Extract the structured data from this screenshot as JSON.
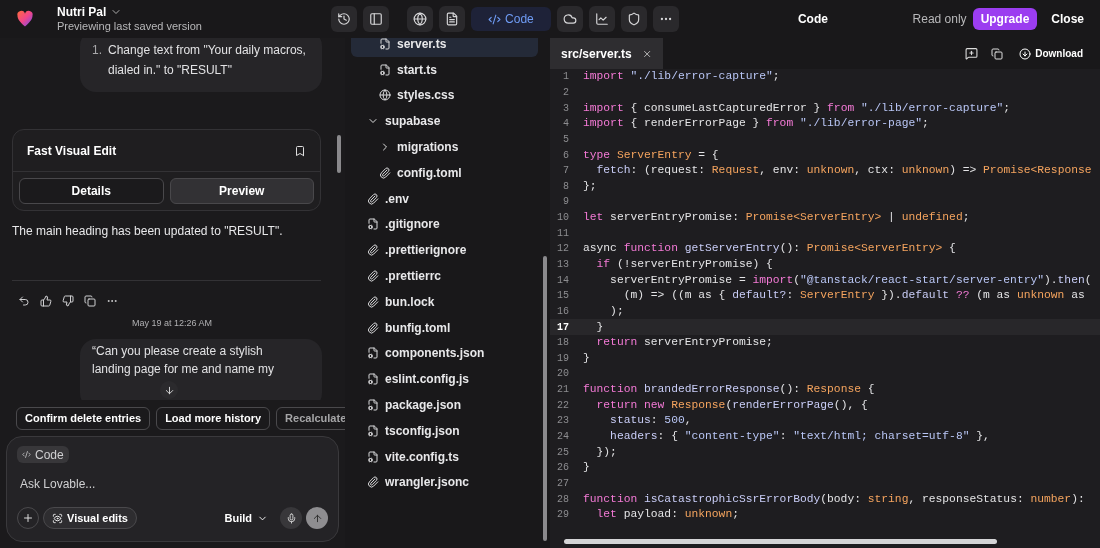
{
  "project": {
    "name": "Nutri Pal",
    "status": "Previewing last saved version"
  },
  "view_tabs": [
    {
      "label": "Code",
      "selected": true
    }
  ],
  "title": "Code",
  "access": "Read only",
  "upgrade_button": "Upgrade",
  "close_button": "Close",
  "chat": {
    "edit_list": [
      {
        "marker": "1.",
        "text": "Change text from \"Your daily macros, dialed in.\" to \"RESULT\""
      }
    ],
    "card": {
      "title": "Fast Visual Edit",
      "buttons": [
        {
          "label": "Details",
          "selected": false
        },
        {
          "label": "Preview",
          "selected": true
        }
      ]
    },
    "reply": "The main heading has been updated to \"RESULT\".",
    "timestamp": "May 19 at 12:26 AM",
    "user_message": "“Can you please create a stylish landing page for me and name my",
    "suggestions": [
      "Confirm delete entries",
      "Load more history",
      "Recalculate"
    ],
    "composer": {
      "tag": "Code",
      "placeholder": "Ask Lovable...",
      "visual_edits": "Visual edits",
      "mode": "Build"
    }
  },
  "tree": [
    {
      "children": [
        {
          "label": "server.ts",
          "kind": "ts",
          "selected": true
        },
        {
          "label": "start.ts",
          "kind": "ts",
          "selected": false
        },
        {
          "label": "styles.css",
          "kind": "css",
          "selected": false
        }
      ]
    },
    {
      "label": "supabase",
      "kind": "folder",
      "expanded": true,
      "selected": false,
      "children": [
        {
          "label": "migrations",
          "kind": "folder",
          "expanded": false,
          "selected": false
        },
        {
          "label": "config.toml",
          "kind": "clip",
          "selected": false
        }
      ]
    },
    {
      "label": ".env",
      "kind": "clip",
      "selected": false
    },
    {
      "label": ".gitignore",
      "kind": "ts",
      "selected": false
    },
    {
      "label": ".prettierignore",
      "kind": "clip",
      "selected": false
    },
    {
      "label": ".prettierrc",
      "kind": "clip",
      "selected": false
    },
    {
      "label": "bun.lock",
      "kind": "clip",
      "selected": false
    },
    {
      "label": "bunfig.toml",
      "kind": "clip",
      "selected": false
    },
    {
      "label": "components.json",
      "kind": "ts",
      "selected": false
    },
    {
      "label": "eslint.config.js",
      "kind": "ts",
      "selected": false
    },
    {
      "label": "package.json",
      "kind": "ts",
      "selected": false
    },
    {
      "label": "tsconfig.json",
      "kind": "ts",
      "selected": false
    },
    {
      "label": "vite.config.ts",
      "kind": "ts",
      "selected": false
    },
    {
      "label": "wrangler.jsonc",
      "kind": "clip",
      "selected": false
    }
  ],
  "editor": {
    "tab": "src/server.ts",
    "download": "Download",
    "lines": [
      {
        "n": "1",
        "selected": false,
        "tokens": [
          {
            "kind": "keyword",
            "text": "import"
          },
          {
            "kind": "string",
            "text": " \"./lib/error-capture\""
          },
          {
            "kind": "plain",
            "text": ";"
          }
        ]
      },
      {
        "n": "2",
        "selected": false
      },
      {
        "n": "3",
        "selected": false,
        "tokens": [
          {
            "kind": "keyword",
            "text": "import"
          },
          {
            "kind": "plain",
            "text": " { consumeLastCapturedError } "
          },
          {
            "kind": "keyword",
            "text": "from"
          },
          {
            "kind": "string",
            "text": " \"./lib/error-capture\""
          },
          {
            "kind": "plain",
            "text": ";"
          }
        ]
      },
      {
        "n": "4",
        "selected": false,
        "tokens": [
          {
            "kind": "keyword",
            "text": "import"
          },
          {
            "kind": "plain",
            "text": " { renderErrorPage } "
          },
          {
            "kind": "keyword",
            "text": "from"
          },
          {
            "kind": "string",
            "text": " \"./lib/error-page\""
          },
          {
            "kind": "plain",
            "text": ";"
          }
        ]
      },
      {
        "n": "5",
        "selected": false
      },
      {
        "n": "6",
        "selected": false,
        "tokens": [
          {
            "kind": "keyword",
            "text": "type"
          },
          {
            "kind": "type",
            "text": " ServerEntry"
          },
          {
            "kind": "plain",
            "text": " = {"
          }
        ]
      },
      {
        "n": "7",
        "selected": false,
        "tokens": [
          {
            "kind": "function",
            "text": "  fetch"
          },
          {
            "kind": "plain",
            "text": ": (request: "
          },
          {
            "kind": "type",
            "text": "Request"
          },
          {
            "kind": "plain",
            "text": ", env: "
          },
          {
            "kind": "type",
            "text": "unknown"
          },
          {
            "kind": "plain",
            "text": ", ctx: "
          },
          {
            "kind": "type",
            "text": "unknown"
          },
          {
            "kind": "plain",
            "text": ") => "
          },
          {
            "kind": "type",
            "text": "Promise<Response"
          }
        ]
      },
      {
        "n": "8",
        "selected": false,
        "tokens": [
          {
            "kind": "plain",
            "text": "};"
          }
        ]
      },
      {
        "n": "9",
        "selected": false
      },
      {
        "n": "10",
        "selected": false,
        "tokens": [
          {
            "kind": "keyword",
            "text": "let"
          },
          {
            "kind": "plain",
            "text": " serverEntryPromise: "
          },
          {
            "kind": "type",
            "text": "Promise<ServerEntry>"
          },
          {
            "kind": "plain",
            "text": " | "
          },
          {
            "kind": "type",
            "text": "undefined"
          },
          {
            "kind": "plain",
            "text": ";"
          }
        ]
      },
      {
        "n": "11",
        "selected": false
      },
      {
        "n": "12",
        "selected": false,
        "tokens": [
          {
            "kind": "plain",
            "text": "async "
          },
          {
            "kind": "keyword",
            "text": "function"
          },
          {
            "kind": "function",
            "text": " getServerEntry"
          },
          {
            "kind": "plain",
            "text": "(): "
          },
          {
            "kind": "type",
            "text": "Promise<ServerEntry>"
          },
          {
            "kind": "plain",
            "text": " {"
          }
        ]
      },
      {
        "n": "13",
        "selected": false,
        "tokens": [
          {
            "kind": "keyword",
            "text": "  if"
          },
          {
            "kind": "plain",
            "text": " (!serverEntryPromise) {"
          }
        ]
      },
      {
        "n": "14",
        "selected": false,
        "tokens": [
          {
            "kind": "plain",
            "text": "    serverEntryPromise = "
          },
          {
            "kind": "keyword",
            "text": "import"
          },
          {
            "kind": "plain",
            "text": "("
          },
          {
            "kind": "string",
            "text": "\"@tanstack/react-start/server-entry\""
          },
          {
            "kind": "plain",
            "text": ")."
          },
          {
            "kind": "function",
            "text": "then"
          },
          {
            "kind": "plain",
            "text": "("
          }
        ]
      },
      {
        "n": "15",
        "selected": false,
        "tokens": [
          {
            "kind": "plain",
            "text": "      (m) => ((m as { "
          },
          {
            "kind": "function",
            "text": "default?"
          },
          {
            "kind": "plain",
            "text": ": "
          },
          {
            "kind": "type",
            "text": "ServerEntry"
          },
          {
            "kind": "plain",
            "text": " })."
          },
          {
            "kind": "function",
            "text": "default"
          },
          {
            "kind": "keyword",
            "text": " ??"
          },
          {
            "kind": "plain",
            "text": " (m as "
          },
          {
            "kind": "type",
            "text": "unknown"
          },
          {
            "kind": "plain",
            "text": " as"
          }
        ]
      },
      {
        "n": "16",
        "selected": false,
        "tokens": [
          {
            "kind": "plain",
            "text": "    );"
          }
        ]
      },
      {
        "n": "17",
        "selected": true,
        "tokens": [
          {
            "kind": "plain",
            "text": "  }"
          }
        ]
      },
      {
        "n": "18",
        "selected": false,
        "tokens": [
          {
            "kind": "keyword",
            "text": "  return"
          },
          {
            "kind": "plain",
            "text": " serverEntryPromise;"
          }
        ]
      },
      {
        "n": "19",
        "selected": false,
        "tokens": [
          {
            "kind": "plain",
            "text": "}"
          }
        ]
      },
      {
        "n": "20",
        "selected": false
      },
      {
        "n": "21",
        "selected": false,
        "tokens": [
          {
            "kind": "keyword",
            "text": "function"
          },
          {
            "kind": "function",
            "text": " brandedErrorResponse"
          },
          {
            "kind": "plain",
            "text": "(): "
          },
          {
            "kind": "type",
            "text": "Response"
          },
          {
            "kind": "plain",
            "text": " {"
          }
        ]
      },
      {
        "n": "22",
        "selected": false,
        "tokens": [
          {
            "kind": "keyword",
            "text": "  return new"
          },
          {
            "kind": "type",
            "text": " Response"
          },
          {
            "kind": "plain",
            "text": "("
          },
          {
            "kind": "function",
            "text": "renderErrorPage"
          },
          {
            "kind": "plain",
            "text": "(), {"
          }
        ]
      },
      {
        "n": "23",
        "selected": false,
        "tokens": [
          {
            "kind": "function",
            "text": "    status"
          },
          {
            "kind": "plain",
            "text": ": "
          },
          {
            "kind": "string",
            "text": "500"
          },
          {
            "kind": "plain",
            "text": ","
          }
        ]
      },
      {
        "n": "24",
        "selected": false,
        "tokens": [
          {
            "kind": "function",
            "text": "    headers"
          },
          {
            "kind": "plain",
            "text": ": { "
          },
          {
            "kind": "string",
            "text": "\"content-type\""
          },
          {
            "kind": "plain",
            "text": ": "
          },
          {
            "kind": "string",
            "text": "\"text/html; charset=utf-8\""
          },
          {
            "kind": "plain",
            "text": " },"
          }
        ]
      },
      {
        "n": "25",
        "selected": false,
        "tokens": [
          {
            "kind": "plain",
            "text": "  });"
          }
        ]
      },
      {
        "n": "26",
        "selected": false,
        "tokens": [
          {
            "kind": "plain",
            "text": "}"
          }
        ]
      },
      {
        "n": "27",
        "selected": false
      },
      {
        "n": "28",
        "selected": false,
        "tokens": [
          {
            "kind": "keyword",
            "text": "function"
          },
          {
            "kind": "function",
            "text": " isCatastrophicSsrErrorBody"
          },
          {
            "kind": "plain",
            "text": "(body: "
          },
          {
            "kind": "type",
            "text": "string"
          },
          {
            "kind": "plain",
            "text": ", responseStatus: "
          },
          {
            "kind": "type",
            "text": "number"
          },
          {
            "kind": "plain",
            "text": "):"
          }
        ]
      },
      {
        "n": "29",
        "selected": false,
        "tokens": [
          {
            "kind": "keyword",
            "text": "  let"
          },
          {
            "kind": "plain",
            "text": " payload: "
          },
          {
            "kind": "type",
            "text": "unknown"
          },
          {
            "kind": "plain",
            "text": ";"
          }
        ]
      }
    ]
  }
}
